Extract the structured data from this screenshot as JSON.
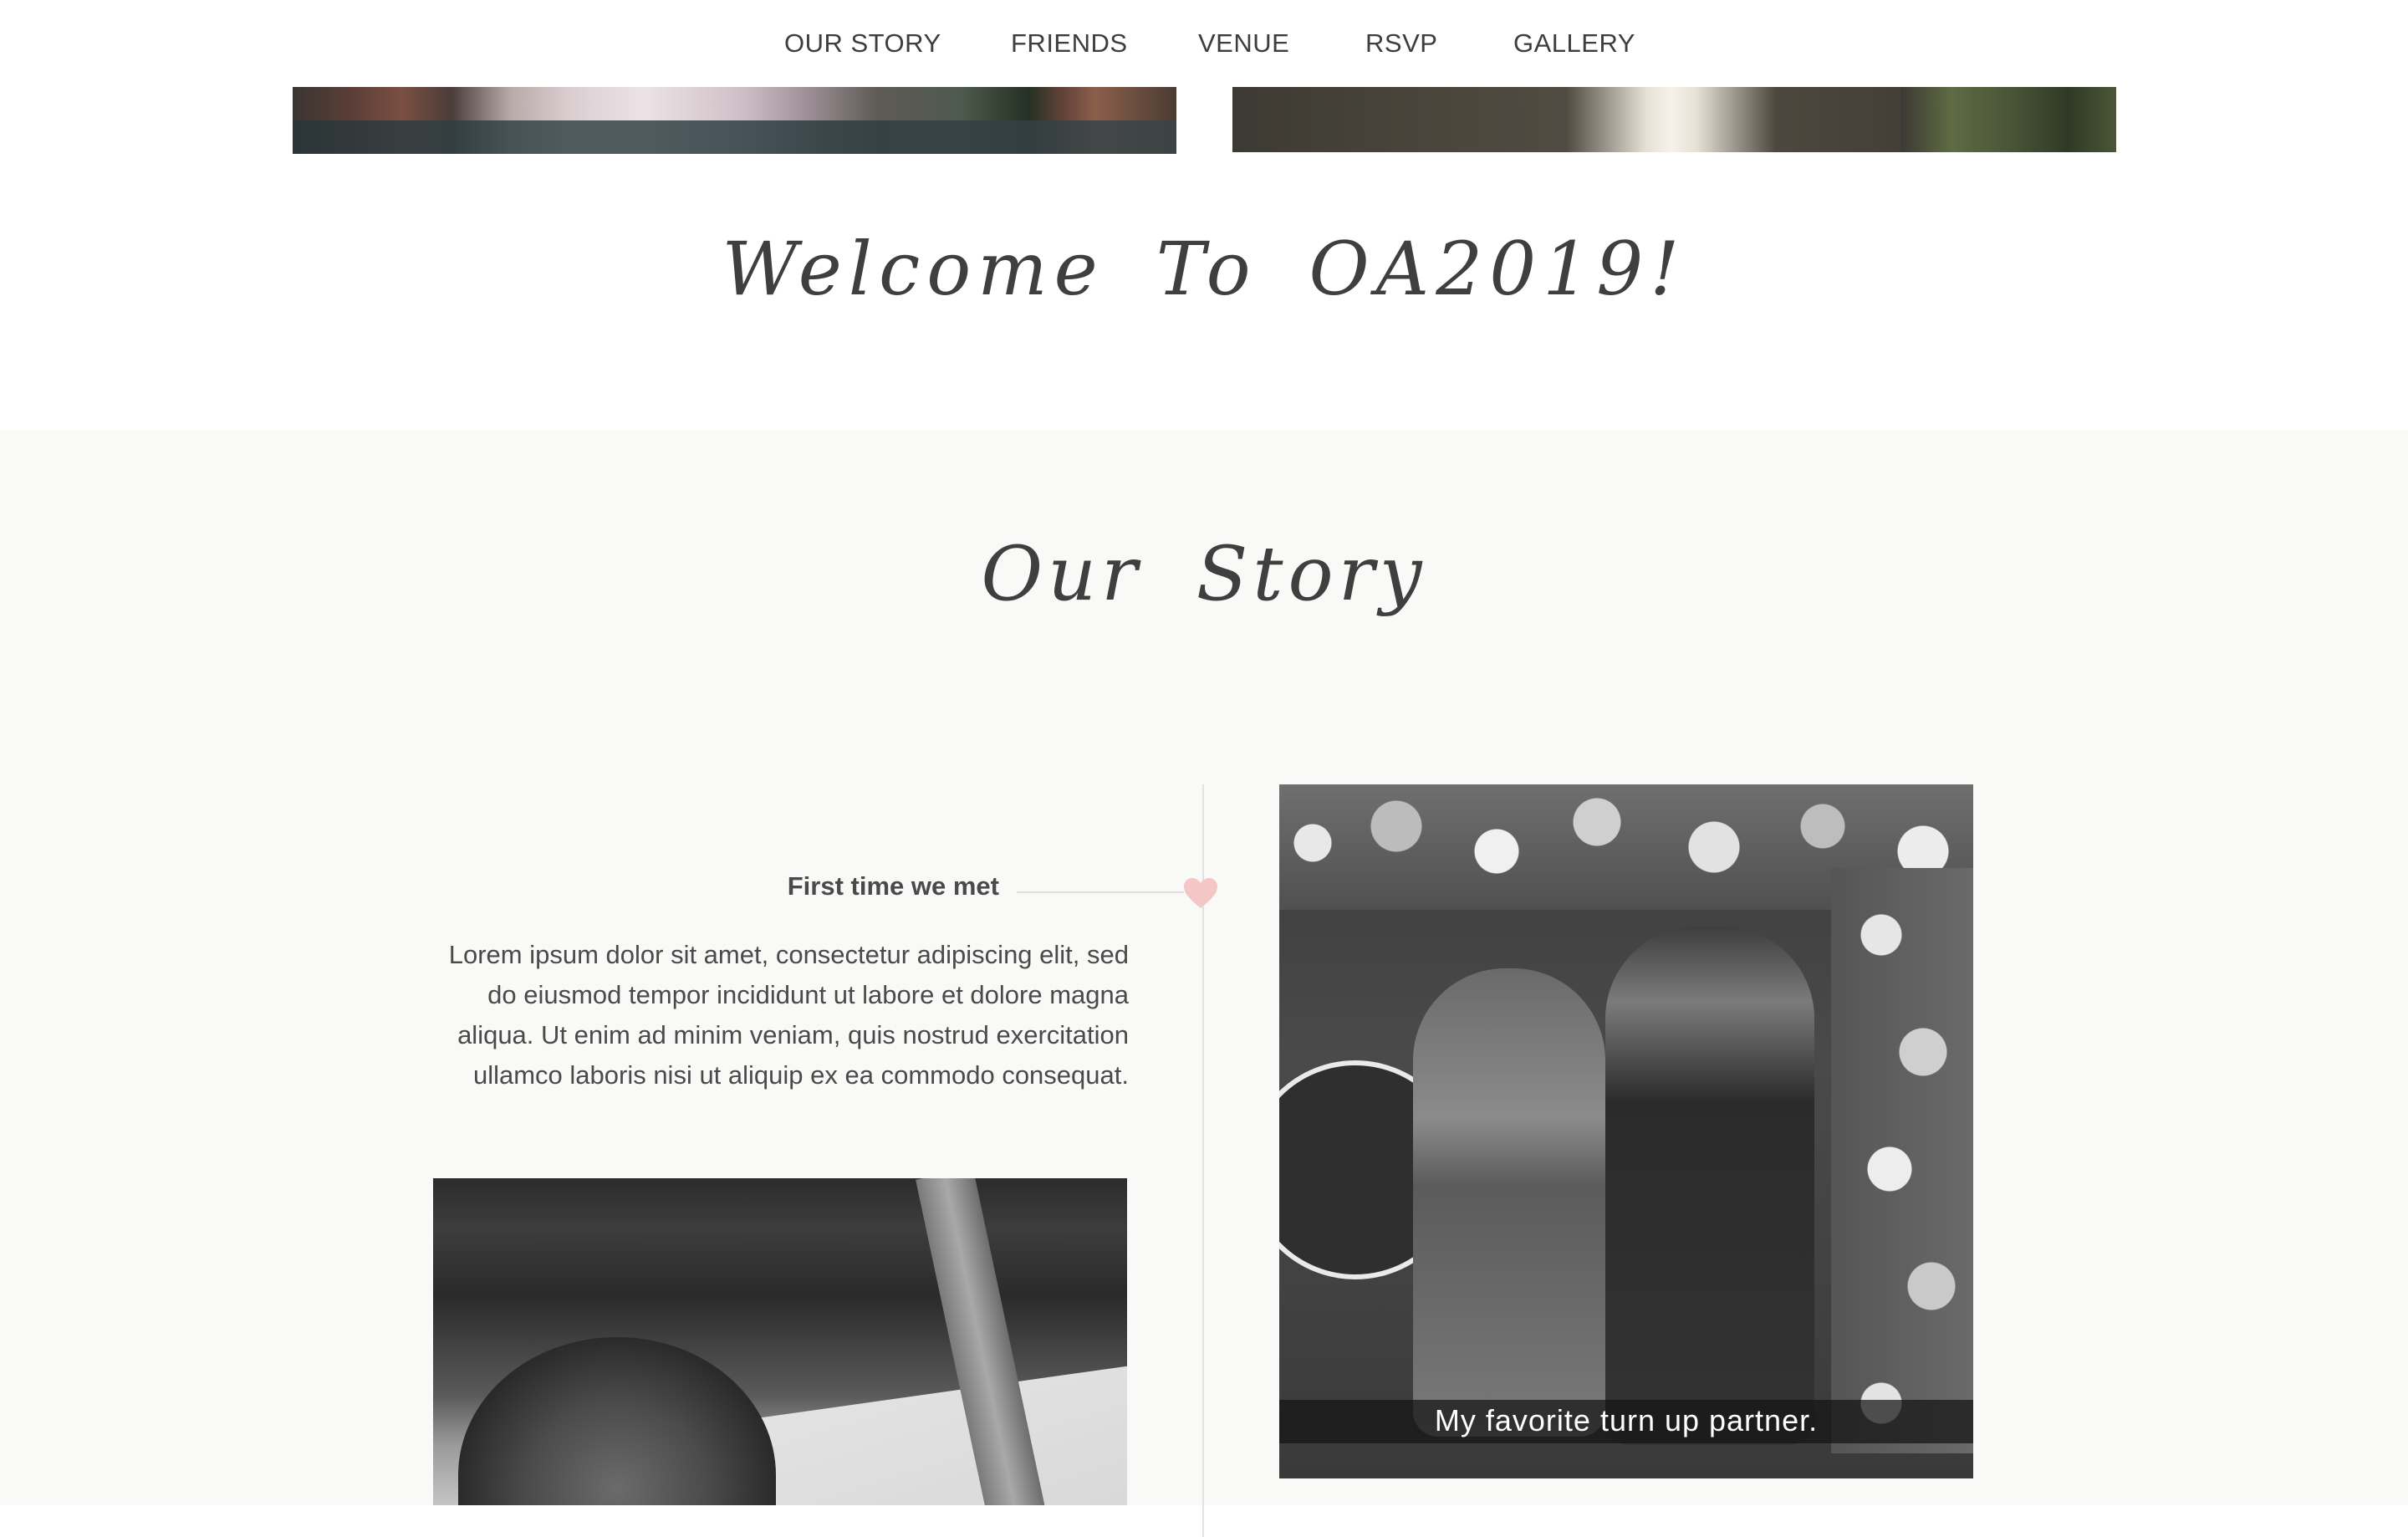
{
  "nav": {
    "items": [
      "OUR STORY",
      "FRIENDS",
      "VENUE",
      "RSVP",
      "GALLERY"
    ]
  },
  "welcome": {
    "heading": "Welcome To OA2019!"
  },
  "story": {
    "heading": "Our Story",
    "events": [
      {
        "title": "First time we met",
        "text": "Lorem ipsum dolor sit amet, consectetur adipiscing elit, sed do eiusmod tempor incididunt ut labore et dolore magna aliqua. Ut enim ad minim veniam, quis nostrud exercitation ullamco laboris nisi ut aliquip ex ea commodo consequat."
      }
    ],
    "photo_caption": "My favorite turn up partner."
  },
  "colors": {
    "heart": "#f5c6c6",
    "section_background": "#f9f9f7",
    "text": "#444444"
  }
}
